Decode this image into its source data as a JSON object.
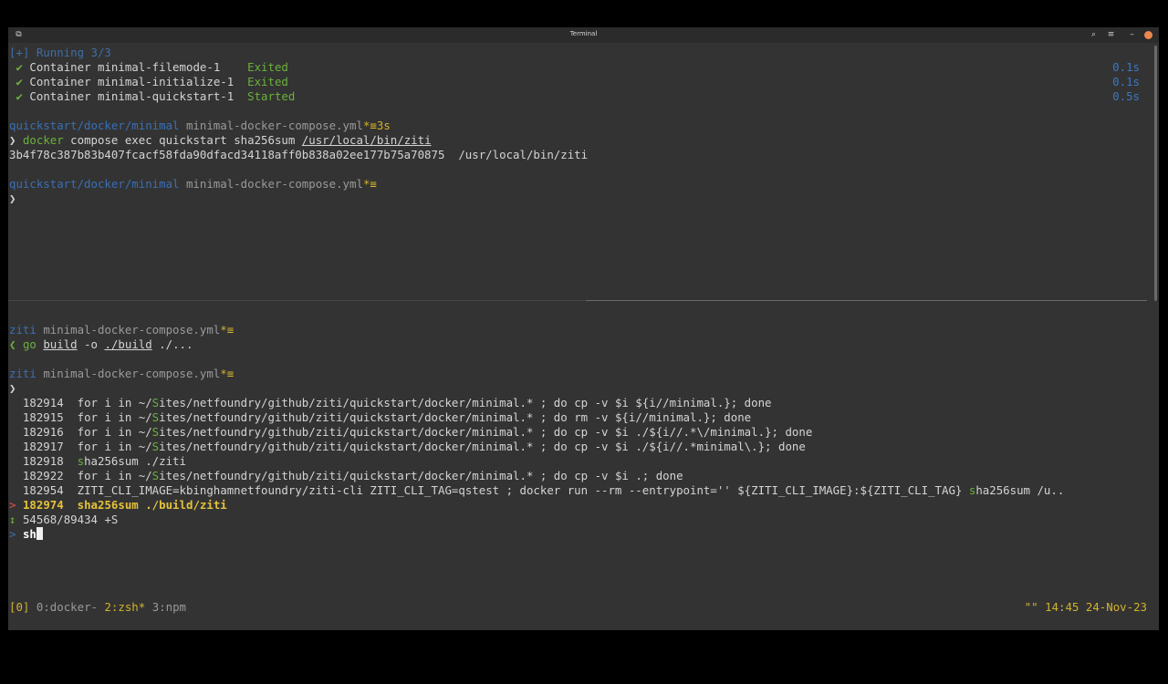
{
  "window": {
    "title": "Terminal"
  },
  "top_pane": {
    "compose": {
      "header": "[+] Running 3/3",
      "rows": [
        {
          "check": "✔",
          "label": "Container minimal-filemode-1    ",
          "status": "Exited",
          "duration": "0.1s"
        },
        {
          "check": "✔",
          "label": "Container minimal-initialize-1  ",
          "status": "Exited",
          "duration": "0.1s"
        },
        {
          "check": "✔",
          "label": "Container minimal-quickstart-1  ",
          "status": "Started",
          "duration": "0.5s"
        }
      ]
    },
    "prompt1": {
      "path": "quickstart/docker/minimal",
      "file": "minimal-docker-compose.yml",
      "mark": "*≡",
      "time": "3s"
    },
    "command1": {
      "arrow": "❯",
      "cmd": "docker",
      "args": " compose exec quickstart sha256sum ",
      "path": "/usr/local/bin/ziti"
    },
    "output1": "3b4f78c387b83b407fcacf58fda90dfacd34118aff0b838a02ee177b75a70875  /usr/local/bin/ziti",
    "prompt2": {
      "path": "quickstart/docker/minimal",
      "file": "minimal-docker-compose.yml",
      "mark": "*≡"
    },
    "prompt2_arrow": "❯"
  },
  "bottom_pane": {
    "prompt1": {
      "path": "ziti",
      "file": "minimal-docker-compose.yml",
      "mark": "*≡"
    },
    "command1": {
      "arrow": "❮",
      "cmd": "go",
      "build": "build",
      "flag": " -o ",
      "out": "./build",
      "rest": " ./..."
    },
    "prompt2": {
      "path": "ziti",
      "file": "minimal-docker-compose.yml",
      "mark": "*≡"
    },
    "prompt2_arrow": "❯",
    "history": [
      {
        "num": "182914",
        "pre": "for i in ~/",
        "s": "S",
        "post": "ites/netfoundry/github/ziti/quickstart/docker/minimal.* ; do cp -v $i ${i//minimal.}; done"
      },
      {
        "num": "182915",
        "pre": "for i in ~/",
        "s": "S",
        "post": "ites/netfoundry/github/ziti/quickstart/docker/minimal.* ; do rm -v ${i//minimal.}; done"
      },
      {
        "num": "182916",
        "pre": "for i in ~/",
        "s": "S",
        "post": "ites/netfoundry/github/ziti/quickstart/docker/minimal.* ; do cp -v $i ./${i//.*\\/minimal.}; done"
      },
      {
        "num": "182917",
        "pre": "for i in ~/",
        "s": "S",
        "post": "ites/netfoundry/github/ziti/quickstart/docker/minimal.* ; do cp -v $i ./${i//.*minimal\\.}; done"
      },
      {
        "num": "182918",
        "pre": "",
        "s": "s",
        "post": "ha256sum ./ziti"
      },
      {
        "num": "182922",
        "pre": "for i in ~/",
        "s": "S",
        "post": "ites/netfoundry/github/ziti/quickstart/docker/minimal.* ; do cp -v $i .; done"
      },
      {
        "num": "182954",
        "pre": "ZITI_CLI_IMAGE=kbinghamnetfoundry/ziti-cli ZITI_CLI_TAG=qstest ; docker run --rm --entrypoint='' ${ZITI_CLI_IMAGE}:${ZITI_CLI_TAG} ",
        "s": "s",
        "post": "ha256sum /u.."
      }
    ],
    "selected": {
      "marker": ">",
      "num": "182974",
      "cmd": "sha256sum ./build/ziti"
    },
    "counter": {
      "marker": "↕",
      "text": "54568/89434 +S"
    },
    "query": {
      "marker": ">",
      "text": "sh"
    }
  },
  "status_bar": {
    "session": "[0]",
    "windows": [
      {
        "label": "0:docker-",
        "active": false
      },
      {
        "label": "2:zsh*",
        "active": true
      },
      {
        "label": "3:npm",
        "active": false
      }
    ],
    "right": "\"\" 14:45 24-Nov-23"
  },
  "colors": {
    "prompt_path": "#3a6fb5",
    "status_ok": "#6bb23a",
    "accent": "#d3b32c",
    "close_button": "#e9874f"
  }
}
